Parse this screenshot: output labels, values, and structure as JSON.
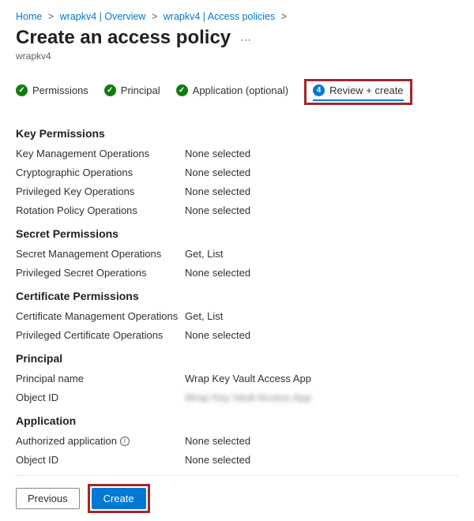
{
  "breadcrumb": {
    "items": [
      {
        "label": "Home"
      },
      {
        "label": "wrapkv4 | Overview"
      },
      {
        "label": "wrapkv4 | Access policies"
      }
    ],
    "sep": ">"
  },
  "page": {
    "title": "Create an access policy",
    "subtitle": "wrapkv4"
  },
  "tabs": {
    "permissions": "Permissions",
    "principal": "Principal",
    "application": "Application (optional)",
    "review": "Review + create",
    "step_number": "4",
    "check": "✓"
  },
  "sections": {
    "key": {
      "heading": "Key Permissions",
      "rows": [
        {
          "label": "Key Management Operations",
          "value": "None selected"
        },
        {
          "label": "Cryptographic Operations",
          "value": "None selected"
        },
        {
          "label": "Privileged Key Operations",
          "value": "None selected"
        },
        {
          "label": "Rotation Policy Operations",
          "value": "None selected"
        }
      ]
    },
    "secret": {
      "heading": "Secret Permissions",
      "rows": [
        {
          "label": "Secret Management Operations",
          "value": "Get, List"
        },
        {
          "label": "Privileged Secret Operations",
          "value": "None selected"
        }
      ]
    },
    "certificate": {
      "heading": "Certificate Permissions",
      "rows": [
        {
          "label": "Certificate Management Operations",
          "value": "Get, List"
        },
        {
          "label": "Privileged Certificate Operations",
          "value": "None selected"
        }
      ]
    },
    "principal": {
      "heading": "Principal",
      "rows": [
        {
          "label": "Principal name",
          "value": "Wrap Key Vault Access App"
        },
        {
          "label": "Object ID",
          "value": "Wrap Key Vault Access App"
        }
      ]
    },
    "application": {
      "heading": "Application",
      "rows": [
        {
          "label": "Authorized application",
          "value": "None selected"
        },
        {
          "label": "Object ID",
          "value": "None selected"
        }
      ]
    }
  },
  "footer": {
    "previous": "Previous",
    "create": "Create"
  },
  "info_glyph": "i"
}
